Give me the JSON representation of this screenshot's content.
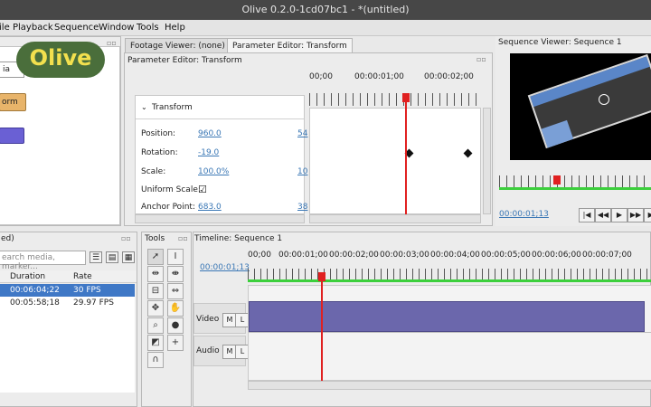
{
  "window": {
    "title": "Olive 0.2.0-1cd07bc1 - *(untitled)"
  },
  "logo": {
    "text": "Olive",
    "color": "#4a6e3b"
  },
  "menu": [
    "File",
    "Playback",
    "Sequence",
    "Window",
    "Tools",
    "Help"
  ],
  "left_panel": {
    "field_text": "ia",
    "orange_button": "orm",
    "colors": {
      "orange": "#e8b46a",
      "purple": "#6a60d4"
    }
  },
  "tabs": {
    "footage_viewer": "Footage Viewer: (none)",
    "parameter_editor": "Parameter Editor: Transform"
  },
  "param_editor": {
    "header": "Parameter Editor: Transform",
    "group": "Transform",
    "rows": [
      {
        "label": "Position:",
        "value": "960.0",
        "value2": "54"
      },
      {
        "label": "Rotation:",
        "value": "-19.0",
        "value2": ""
      },
      {
        "label": "Scale:",
        "value": "100.0%",
        "value2": "10"
      },
      {
        "label": "Uniform Scale:",
        "value": "☑",
        "value2": ""
      },
      {
        "label": "Anchor Point:",
        "value": "683.0",
        "value2": "38"
      }
    ],
    "ruler": [
      "00;00",
      "00:00:01;00",
      "00:00:02;00"
    ]
  },
  "sequence_viewer": {
    "title": "Sequence Viewer: Sequence 1",
    "timecode": "00:00:01;13"
  },
  "project": {
    "title": "ed)",
    "search_placeholder": "earch media, marker...",
    "columns": [
      "Duration",
      "Rate"
    ],
    "rows": [
      {
        "duration": "00:06:04;22",
        "rate": "30 FPS"
      },
      {
        "duration": "00:05:58;18",
        "rate": "29.97 FPS"
      }
    ]
  },
  "tools": {
    "title": "Tools"
  },
  "timeline": {
    "title": "Timeline: Sequence 1",
    "timecode": "00:00:01;13",
    "ruler": [
      "00;00",
      "00:00:01;00",
      "00:00:02;00",
      "00:00:03;00",
      "00:00:04;00",
      "00:00:05;00",
      "00:00:06;00",
      "00:00:07;00"
    ],
    "tracks": [
      {
        "name": "Video 1",
        "m": "M",
        "l": "L"
      },
      {
        "name": "Audio 1",
        "m": "M",
        "l": "L"
      }
    ],
    "colors": {
      "clip": "#6b67ac",
      "playhead": "#e02020",
      "green_bar": "#3ccf3c"
    }
  }
}
